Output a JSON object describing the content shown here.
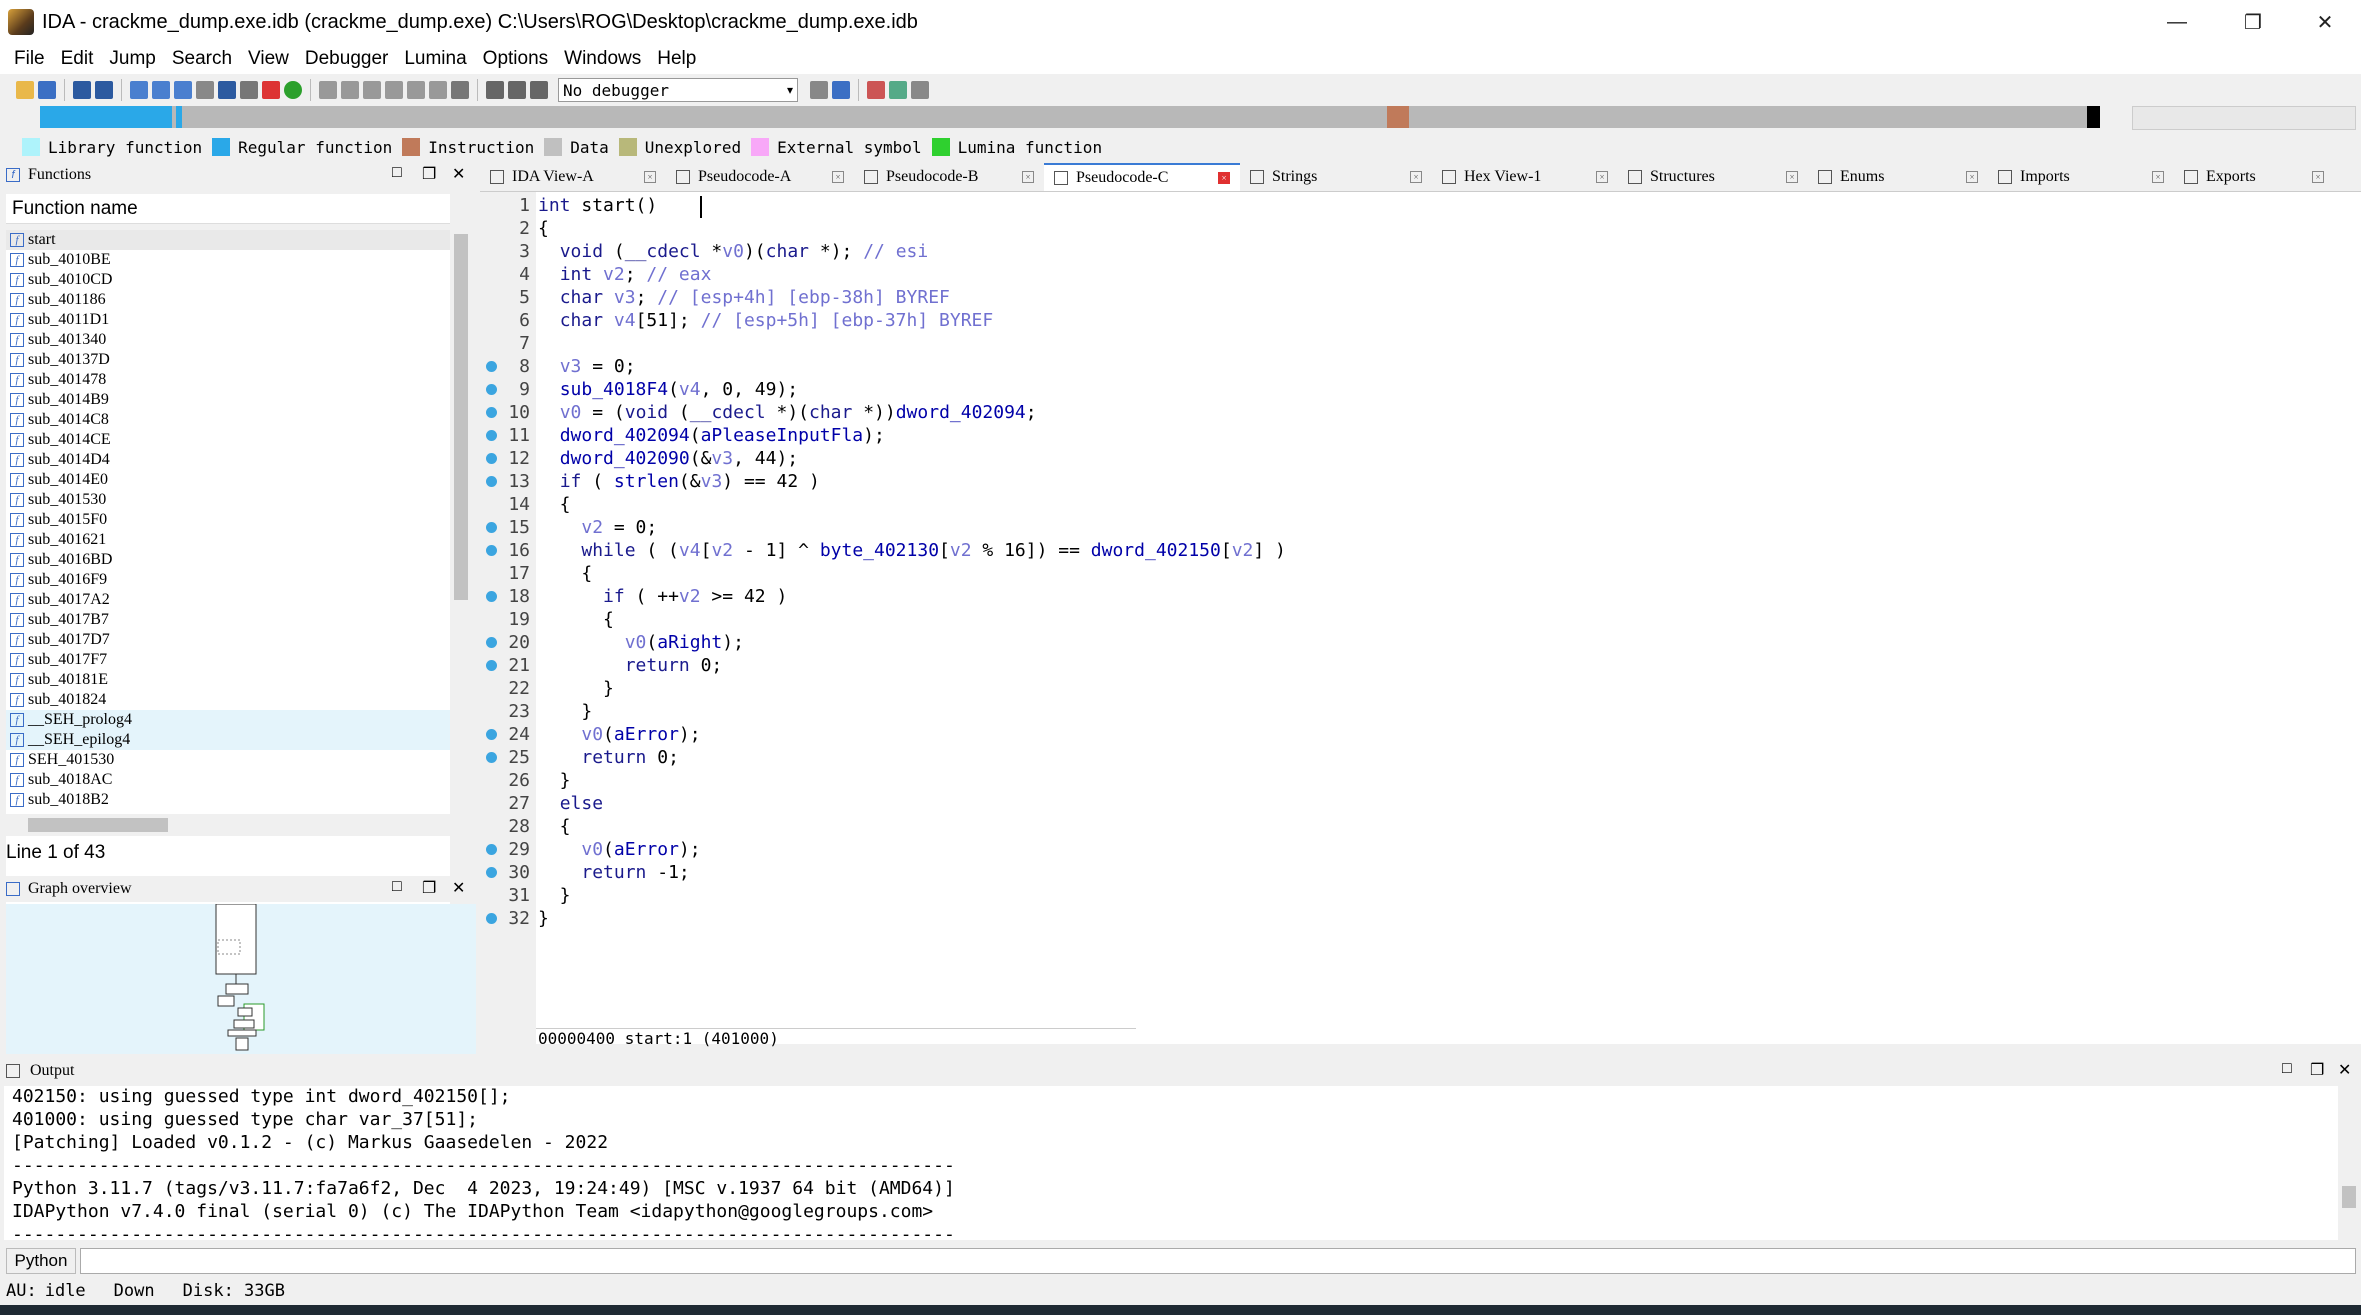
{
  "window": {
    "title": "IDA - crackme_dump.exe.idb (crackme_dump.exe) C:\\Users\\ROG\\Desktop\\crackme_dump.exe.idb",
    "minimize": "—",
    "restore": "❐",
    "close": "✕"
  },
  "menu": [
    "File",
    "Edit",
    "Jump",
    "Search",
    "View",
    "Debugger",
    "Lumina",
    "Options",
    "Windows",
    "Help"
  ],
  "toolbar": {
    "debugger": "No debugger"
  },
  "legend": [
    {
      "label": "Library function",
      "color": "#aef3fb"
    },
    {
      "label": "Regular function",
      "color": "#2aa8e8"
    },
    {
      "label": "Instruction",
      "color": "#c07a5a"
    },
    {
      "label": "Data",
      "color": "#c0c0c0"
    },
    {
      "label": "Unexplored",
      "color": "#b8b87a"
    },
    {
      "label": "External symbol",
      "color": "#f8a8f8"
    },
    {
      "label": "Lumina function",
      "color": "#2fd02f"
    }
  ],
  "functions": {
    "title": "Functions",
    "header": "Function name",
    "items": [
      "start",
      "sub_4010BE",
      "sub_4010CD",
      "sub_401186",
      "sub_4011D1",
      "sub_401340",
      "sub_40137D",
      "sub_401478",
      "sub_4014B9",
      "sub_4014C8",
      "sub_4014CE",
      "sub_4014D4",
      "sub_4014E0",
      "sub_401530",
      "sub_4015F0",
      "sub_401621",
      "sub_4016BD",
      "sub_4016F9",
      "sub_4017A2",
      "sub_4017B7",
      "sub_4017D7",
      "sub_4017F7",
      "sub_40181E",
      "sub_401824",
      "__SEH_prolog4",
      "__SEH_epilog4",
      "SEH_401530",
      "sub_4018AC",
      "sub_4018B2"
    ],
    "status": "Line 1 of 43"
  },
  "graph": {
    "title": "Graph overview"
  },
  "tabs": [
    {
      "label": "IDA View-A",
      "active": false
    },
    {
      "label": "Pseudocode-A",
      "active": false
    },
    {
      "label": "Pseudocode-B",
      "active": false
    },
    {
      "label": "Pseudocode-C",
      "active": true
    },
    {
      "label": "Strings",
      "active": false
    },
    {
      "label": "Hex View-1",
      "active": false
    },
    {
      "label": "Structures",
      "active": false
    },
    {
      "label": "Enums",
      "active": false
    },
    {
      "label": "Imports",
      "active": false
    },
    {
      "label": "Exports",
      "active": false
    }
  ],
  "code": {
    "lines": [
      {
        "n": "1",
        "bp": false,
        "t": "int start()"
      },
      {
        "n": "2",
        "bp": false,
        "t": "{"
      },
      {
        "n": "3",
        "bp": false,
        "t": "  void (__cdecl *v0)(char *); // esi"
      },
      {
        "n": "4",
        "bp": false,
        "t": "  int v2; // eax"
      },
      {
        "n": "5",
        "bp": false,
        "t": "  char v3; // [esp+4h] [ebp-38h] BYREF"
      },
      {
        "n": "6",
        "bp": false,
        "t": "  char v4[51]; // [esp+5h] [ebp-37h] BYREF"
      },
      {
        "n": "7",
        "bp": false,
        "t": ""
      },
      {
        "n": "8",
        "bp": true,
        "t": "  v3 = 0;"
      },
      {
        "n": "9",
        "bp": true,
        "t": "  sub_4018F4(v4, 0, 49);"
      },
      {
        "n": "10",
        "bp": true,
        "t": "  v0 = (void (__cdecl *)(char *))dword_402094;"
      },
      {
        "n": "11",
        "bp": true,
        "t": "  dword_402094(aPleaseInputFla);"
      },
      {
        "n": "12",
        "bp": true,
        "t": "  dword_402090(&v3, 44);"
      },
      {
        "n": "13",
        "bp": true,
        "t": "  if ( strlen(&v3) == 42 )"
      },
      {
        "n": "14",
        "bp": false,
        "t": "  {"
      },
      {
        "n": "15",
        "bp": true,
        "t": "    v2 = 0;"
      },
      {
        "n": "16",
        "bp": true,
        "t": "    while ( (v4[v2 - 1] ^ byte_402130[v2 % 16]) == dword_402150[v2] )"
      },
      {
        "n": "17",
        "bp": false,
        "t": "    {"
      },
      {
        "n": "18",
        "bp": true,
        "t": "      if ( ++v2 >= 42 )"
      },
      {
        "n": "19",
        "bp": false,
        "t": "      {"
      },
      {
        "n": "20",
        "bp": true,
        "t": "        v0(aRight);"
      },
      {
        "n": "21",
        "bp": true,
        "t": "        return 0;"
      },
      {
        "n": "22",
        "bp": false,
        "t": "      }"
      },
      {
        "n": "23",
        "bp": false,
        "t": "    }"
      },
      {
        "n": "24",
        "bp": true,
        "t": "    v0(aError);"
      },
      {
        "n": "25",
        "bp": true,
        "t": "    return 0;"
      },
      {
        "n": "26",
        "bp": false,
        "t": "  }"
      },
      {
        "n": "27",
        "bp": false,
        "t": "  else"
      },
      {
        "n": "28",
        "bp": false,
        "t": "  {"
      },
      {
        "n": "29",
        "bp": true,
        "t": "    v0(aError);"
      },
      {
        "n": "30",
        "bp": true,
        "t": "    return -1;"
      },
      {
        "n": "31",
        "bp": false,
        "t": "  }"
      },
      {
        "n": "32",
        "bp": true,
        "t": "}"
      }
    ],
    "status": "00000400 start:1 (401000)"
  },
  "output": {
    "title": "Output",
    "lines": [
      "402150: using guessed type int dword_402150[];",
      "401000: using guessed type char var_37[51];",
      "[Patching] Loaded v0.1.2 - (c) Markus Gaasedelen - 2022",
      "---------------------------------------------------------------------------------------",
      "Python 3.11.7 (tags/v3.11.7:fa7a6f2, Dec  4 2023, 19:24:49) [MSC v.1937 64 bit (AMD64)]",
      "IDAPython v7.4.0 final (serial 0) (c) The IDAPython Team <idapython@googlegroups.com>",
      "---------------------------------------------------------------------------------------"
    ]
  },
  "python": {
    "button": "Python"
  },
  "statusbar": {
    "au": "AU:",
    "state": "idle",
    "dir": "Down",
    "disk": "Disk: 33GB"
  }
}
